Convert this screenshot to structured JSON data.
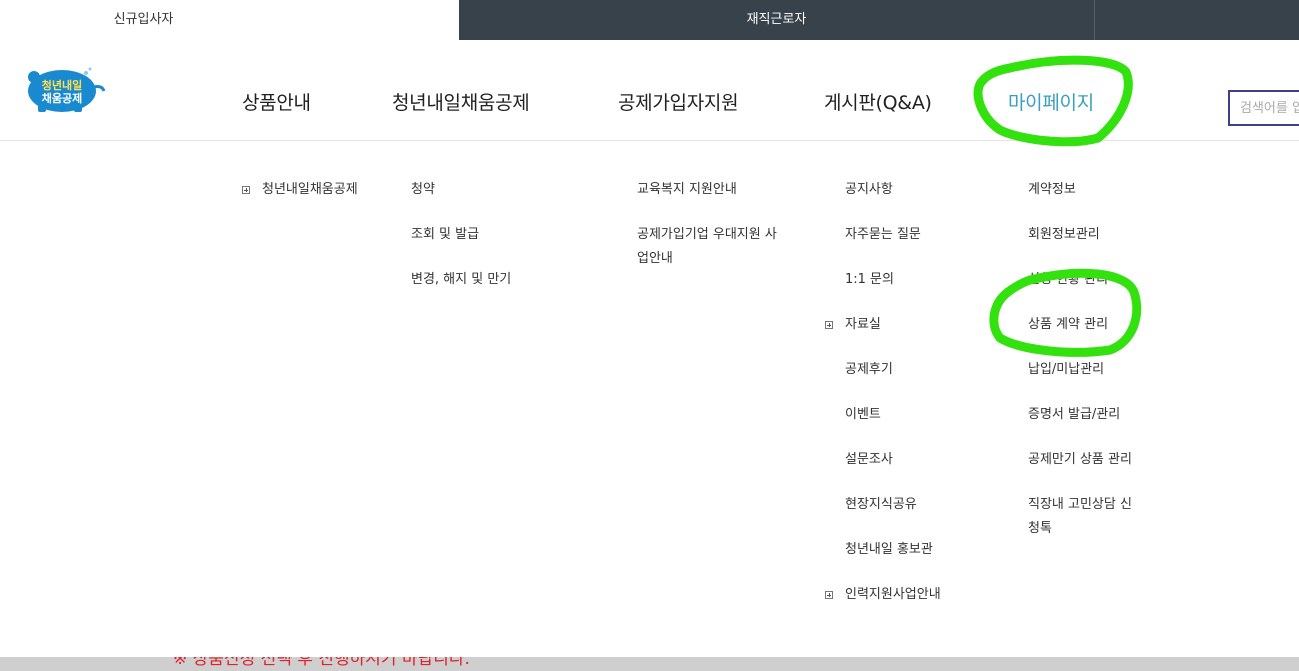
{
  "top_tabs": {
    "new_employee": "신규입사자",
    "current_worker": "재직근로자"
  },
  "logo": {
    "line1": "청년내일",
    "line2": "채움공제",
    "color": "#1a8ad0"
  },
  "gnb": {
    "items": [
      "상품안내",
      "청년내일채움공제",
      "공제가입자지원",
      "게시판(Q&A)",
      "마이페이지"
    ],
    "active_color": "#3a9fc0"
  },
  "search": {
    "placeholder": "검색어를 입력하세요"
  },
  "submenu": {
    "product": [
      "청년내일채움공제"
    ],
    "fund": [
      "청약",
      "조회 및 발급",
      "변경, 해지 및 만기"
    ],
    "support": [
      "교육복지 지원안내",
      "공제가입기업 우대지원 사업안내"
    ],
    "board": [
      "공지사항",
      "자주묻는 질문",
      "1:1 문의",
      "자료실",
      "공제후기",
      "이벤트",
      "설문조사",
      "현장지식공유",
      "청년내일 홍보관",
      "인력지원사업안내"
    ],
    "mypage": [
      "계약정보",
      "회원정보관리",
      "신청 현황 관리",
      "상품 계약 관리",
      "납입/미납관리",
      "증명서 발급/관리",
      "공제만기 상품 관리",
      "직장내 고민상담 신청톡"
    ]
  },
  "notice": {
    "text": "※ 상품신청 선택 후 진행하시기 바랍니다."
  },
  "annotation_color": "#33e10f"
}
